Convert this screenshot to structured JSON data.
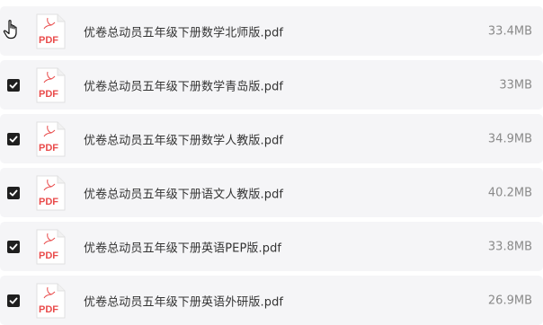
{
  "file_type_label": "PDF",
  "files": [
    {
      "name": "优卷总动员五年级下册数学北师版.pdf",
      "size": "33.4MB",
      "checked": false
    },
    {
      "name": "优卷总动员五年级下册数学青岛版.pdf",
      "size": "33MB",
      "checked": true
    },
    {
      "name": "优卷总动员五年级下册数学人教版.pdf",
      "size": "34.9MB",
      "checked": true
    },
    {
      "name": "优卷总动员五年级下册语文人教版.pdf",
      "size": "40.2MB",
      "checked": true
    },
    {
      "name": "优卷总动员五年级下册英语PEP版.pdf",
      "size": "33.8MB",
      "checked": true
    },
    {
      "name": "优卷总动员五年级下册英语外研版.pdf",
      "size": "26.9MB",
      "checked": true
    }
  ],
  "colors": {
    "row_bg": "#f5f5f7",
    "pdf_red": "#e94b4b",
    "checkbox": "#1f1f1f"
  },
  "icons": {
    "file": "pdf-file-icon",
    "check": "checkmark-icon",
    "pointer": "hand-pointer-icon"
  }
}
